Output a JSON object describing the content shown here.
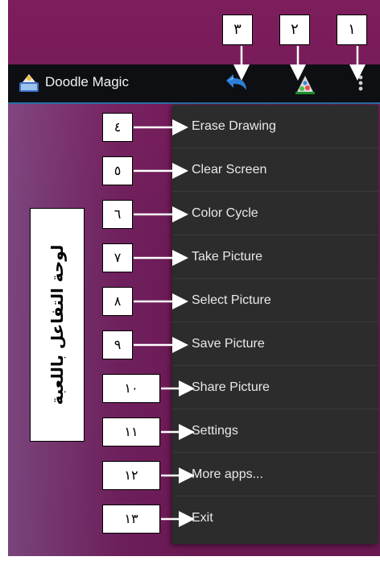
{
  "app": {
    "title": "Doodle Magic"
  },
  "toolbar": {
    "icons": [
      "undo-icon",
      "palette-icon",
      "overflow-menu-icon"
    ]
  },
  "menu": {
    "items": [
      {
        "label": "Erase Drawing"
      },
      {
        "label": "Clear Screen"
      },
      {
        "label": "Color Cycle"
      },
      {
        "label": "Take Picture"
      },
      {
        "label": "Select Picture"
      },
      {
        "label": "Save Picture"
      },
      {
        "label": "Share Picture"
      },
      {
        "label": "Settings"
      },
      {
        "label": "More apps..."
      },
      {
        "label": "Exit"
      }
    ]
  },
  "annotations": {
    "top_labels": [
      "٣",
      "٢",
      "١"
    ],
    "menu_labels": [
      "٤",
      "٥",
      "٦",
      "٧",
      "٨",
      "٩",
      "١٠",
      "١١",
      "١٢",
      "١٣"
    ],
    "side_label": "لوحة التفاعل باللعبة"
  },
  "colors": {
    "screen_background": "#7d1d5c",
    "action_bar": "#0d0f12",
    "action_bar_divider": "#2b6fa8",
    "menu_background": "#2c2c2c",
    "menu_text": "#e9e9e9"
  }
}
